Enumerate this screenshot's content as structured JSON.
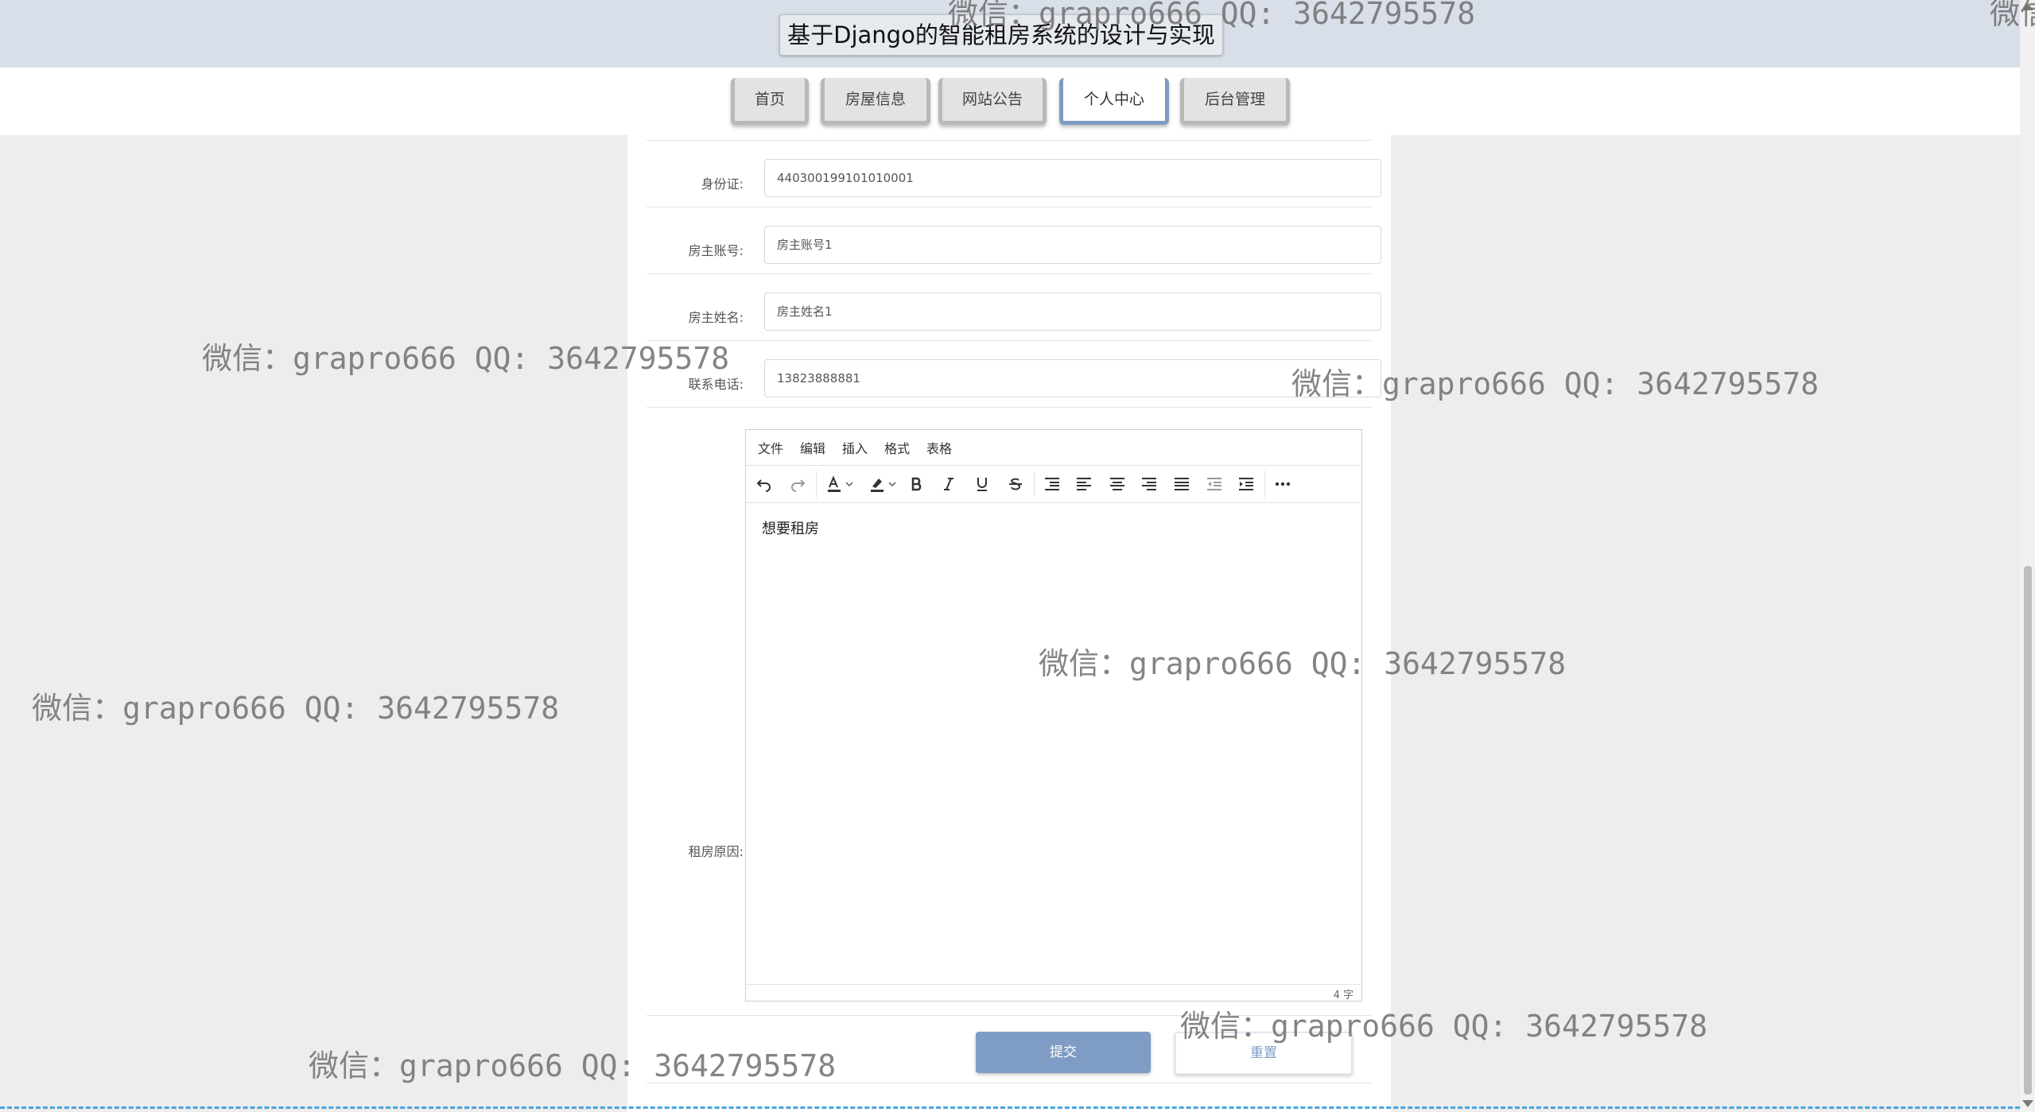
{
  "header": {
    "site_title": "基于Django的智能租房系统的设计与实现"
  },
  "nav": {
    "items": [
      {
        "label": "首页",
        "active": false
      },
      {
        "label": "房屋信息",
        "active": false
      },
      {
        "label": "网站公告",
        "active": false
      },
      {
        "label": "个人中心",
        "active": true
      },
      {
        "label": "后台管理",
        "active": false
      }
    ]
  },
  "form": {
    "id_card": {
      "label": "身份证:",
      "value": "440300199101010001"
    },
    "landlord_account": {
      "label": "房主账号:",
      "value": "房主账号1"
    },
    "landlord_name": {
      "label": "房主姓名:",
      "value": "房主姓名1"
    },
    "phone": {
      "label": "联系电话:",
      "value": "13823888881"
    },
    "reason": {
      "label": "租房原因:"
    }
  },
  "editor": {
    "menu": [
      "文件",
      "编辑",
      "插入",
      "格式",
      "表格"
    ],
    "content": "想要租房",
    "word_count": "4 字",
    "toolbar_icons": [
      "undo-icon",
      "redo-icon",
      "font-color-icon",
      "highlight-icon",
      "bold-icon",
      "italic-icon",
      "underline-icon",
      "strikethrough-icon",
      "line-height-icon",
      "align-left-icon",
      "align-center-icon",
      "align-right-icon",
      "align-justify-icon",
      "outdent-icon",
      "indent-icon",
      "more-icon"
    ]
  },
  "buttons": {
    "submit": "提交",
    "reset": "重置"
  },
  "watermark": {
    "text": "微信：grapro666 QQ: 3642795578",
    "partial_top": "微信：grapro666 QQ: 3642795578",
    "partial_right": "微信"
  },
  "colors": {
    "accent": "#7f9cc5",
    "header_bg": "#d9dfe8",
    "page_bg": "#ededed"
  }
}
